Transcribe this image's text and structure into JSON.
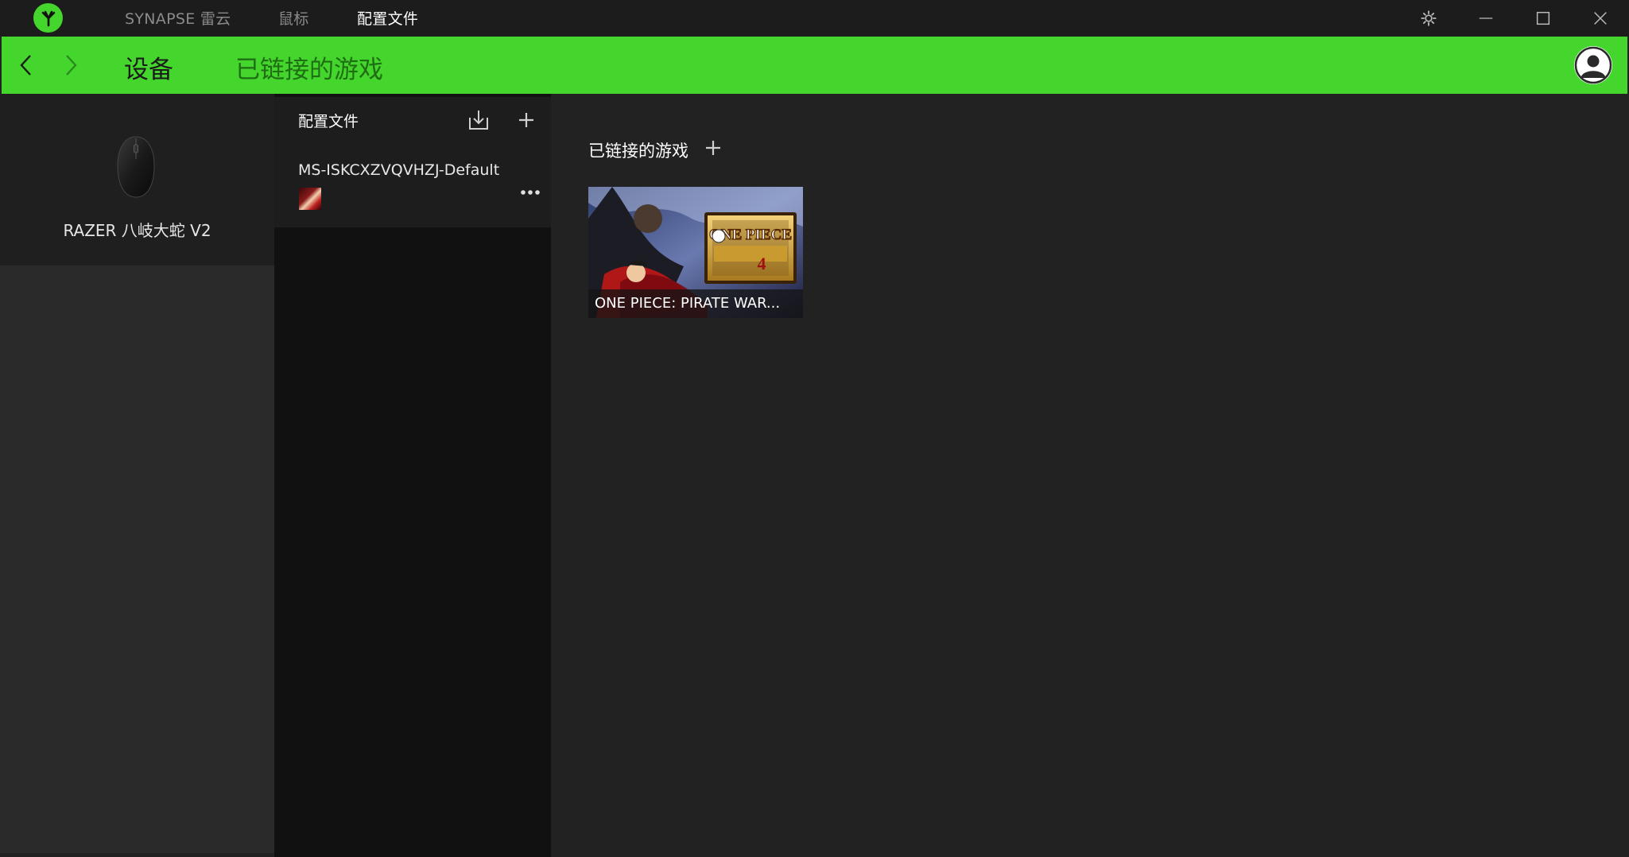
{
  "titlebar": {
    "tabs": [
      {
        "label": "SYNAPSE 雷云",
        "active": false
      },
      {
        "label": "鼠标",
        "active": false
      },
      {
        "label": "配置文件",
        "active": true
      }
    ],
    "icons": [
      "razer-logo-icon",
      "gear-icon",
      "minimize-icon",
      "maximize-icon",
      "close-icon"
    ]
  },
  "header": {
    "back_icon": "chevron-left-icon",
    "forward_icon": "chevron-right-icon",
    "title": "设备",
    "subtitle": "已链接的游戏",
    "avatar_icon": "user-icon"
  },
  "device": {
    "name": "RAZER 八岐大蛇 V2",
    "icon": "mouse-icon"
  },
  "profiles": {
    "title": "配置文件",
    "import_icon": "import-icon",
    "add_icon": "plus-icon",
    "items": [
      {
        "name": "MS-ISKCXZVQVHZJ-Default",
        "menu_icon": "more-dots-icon"
      }
    ]
  },
  "main": {
    "linked_games_title": "已链接的游戏",
    "add_icon": "plus-icon",
    "games": [
      {
        "title": "ONE PIECE: PIRATE WAR...",
        "logo_text": "ONE PIECE"
      }
    ]
  },
  "colors": {
    "accent": "#44d62c",
    "titlebar_bg": "#1c1c1c",
    "panel_bg": "#222222",
    "profiles_bg": "#111111",
    "text_primary": "#ffffff",
    "text_muted": "#8a8a8a"
  }
}
